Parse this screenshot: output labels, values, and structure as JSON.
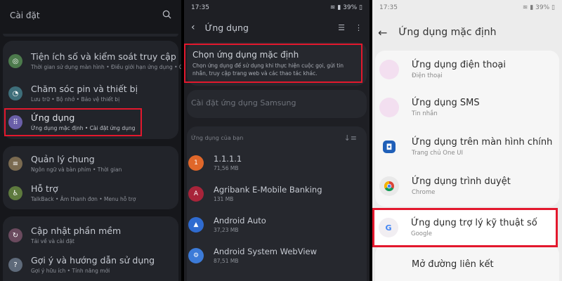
{
  "panel1": {
    "title": "Cài đặt",
    "items": [
      {
        "title": "Tiện ích số và kiểm soát truy cập",
        "sub": "Thời gian sử dụng màn hình  •  Điều giới hạn ứng dụng  •  Chế độ Ngủ",
        "icon": "digital-wellbeing-icon",
        "color": "#4c7a4c"
      },
      {
        "title": "Chăm sóc pin và thiết bị",
        "sub": "Lưu trữ  •  Bộ nhớ  •  Bảo vệ thiết bị",
        "icon": "device-care-icon",
        "color": "#3e6e7a"
      },
      {
        "title": "Ứng dụng",
        "sub": "Ứng dụng mặc định  •  Cài đặt ứng dụng",
        "icon": "apps-icon",
        "color": "#6a5fa8"
      },
      {
        "title": "Quản lý chung",
        "sub": "Ngôn ngữ và bàn phím  •  Thời gian",
        "icon": "general-management-icon",
        "color": "#7a6a50"
      },
      {
        "title": "Hỗ trợ",
        "sub": "TalkBack  •  Âm thanh đơn  •  Menu hỗ trợ",
        "icon": "accessibility-icon",
        "color": "#5e7a3e"
      },
      {
        "title": "Cập nhật phần mềm",
        "sub": "Tải về và cài đặt",
        "icon": "software-update-icon",
        "color": "#6a4a5e"
      },
      {
        "title": "Gợi ý và hướng dẫn sử dụng",
        "sub": "Gợi ý hữu ích  •  Tính năng mới",
        "icon": "tips-icon",
        "color": "#5e6a7a"
      }
    ]
  },
  "panel2": {
    "status_time": "17:35",
    "status_battery": "39%",
    "title": "Ứng dụng",
    "choose_title": "Chọn ứng dụng mặc định",
    "choose_desc": "Chọn ứng dụng để sử dụng khi thực hiện cuộc gọi, gửi tin nhắn, truy cập trang web và các thao tác khác.",
    "samsung": "Cài đặt ứng dụng Samsung",
    "section": "Ứng dụng của bạn",
    "apps": [
      {
        "name": "1.1.1.1",
        "size": "71,56 MB",
        "color": "#e0672a",
        "glyph": "1"
      },
      {
        "name": "Agribank E-Mobile Banking",
        "size": "131 MB",
        "color": "#a8243a",
        "glyph": "A"
      },
      {
        "name": "Android Auto",
        "size": "37,23 MB",
        "color": "#2f6bd0",
        "glyph": "▲"
      },
      {
        "name": "Android System WebView",
        "size": "87,51 MB",
        "color": "#3c7bd8",
        "glyph": "⚙"
      }
    ]
  },
  "panel3": {
    "status_time": "17:35",
    "status_battery": "39%",
    "title": "Ứng dụng mặc định",
    "rows": [
      {
        "title": "Ứng dụng điện thoại",
        "sub": "Điện thoại",
        "icon": "phone-app-icon",
        "bg": "#f3dff0",
        "glyph": ""
      },
      {
        "title": "Ứng dụng SMS",
        "sub": "Tin nhắn",
        "icon": "sms-app-icon",
        "bg": "#f3dff0",
        "glyph": ""
      },
      {
        "title": "Ứng dụng trên màn hình chính",
        "sub": "Trang chủ One UI",
        "icon": "home-app-icon",
        "bg": "#1f5fb8",
        "glyph": "◘"
      },
      {
        "title": "Ứng dụng trình duyệt",
        "sub": "Chrome",
        "icon": "chrome-icon",
        "bg": "#e9e9e9",
        "glyph": "◉"
      },
      {
        "title": "Ứng dụng trợ lý kỹ thuật số",
        "sub": "Google",
        "icon": "google-icon",
        "bg": "#f1eef2",
        "glyph": "G"
      },
      {
        "title": "Mở đường liên kết",
        "sub": "",
        "icon": "",
        "bg": "transparent",
        "glyph": ""
      }
    ]
  }
}
